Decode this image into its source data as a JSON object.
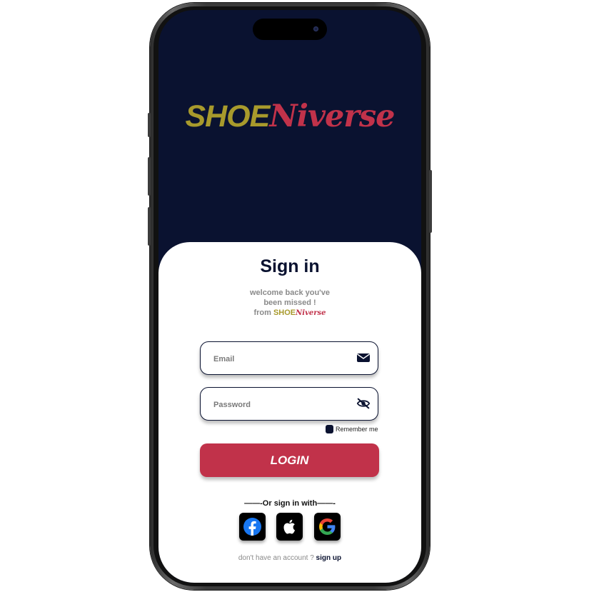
{
  "brand": {
    "part1": "SHOE",
    "part2": "Niverse"
  },
  "signin": {
    "title": "Sign in",
    "welcome_line1": "welcome back you've",
    "welcome_line2": "been missed !",
    "welcome_from": "from ",
    "from_brand_part1": "SHOE",
    "from_brand_part2": "Niverse"
  },
  "form": {
    "email_placeholder": "Email",
    "email_icon": "envelope-icon",
    "password_placeholder": "Password",
    "password_icon": "eye-slash-icon",
    "remember_label": "Remember me",
    "login_label": "LOGIN"
  },
  "social": {
    "divider": "——-Or sign in with——-",
    "providers": [
      "facebook",
      "apple",
      "google"
    ]
  },
  "footer": {
    "prompt": "don't have an account ? ",
    "signup_label": "sign up"
  },
  "colors": {
    "primary": "#0a1230",
    "accent": "#c1324a",
    "gold": "#a89a2c"
  }
}
